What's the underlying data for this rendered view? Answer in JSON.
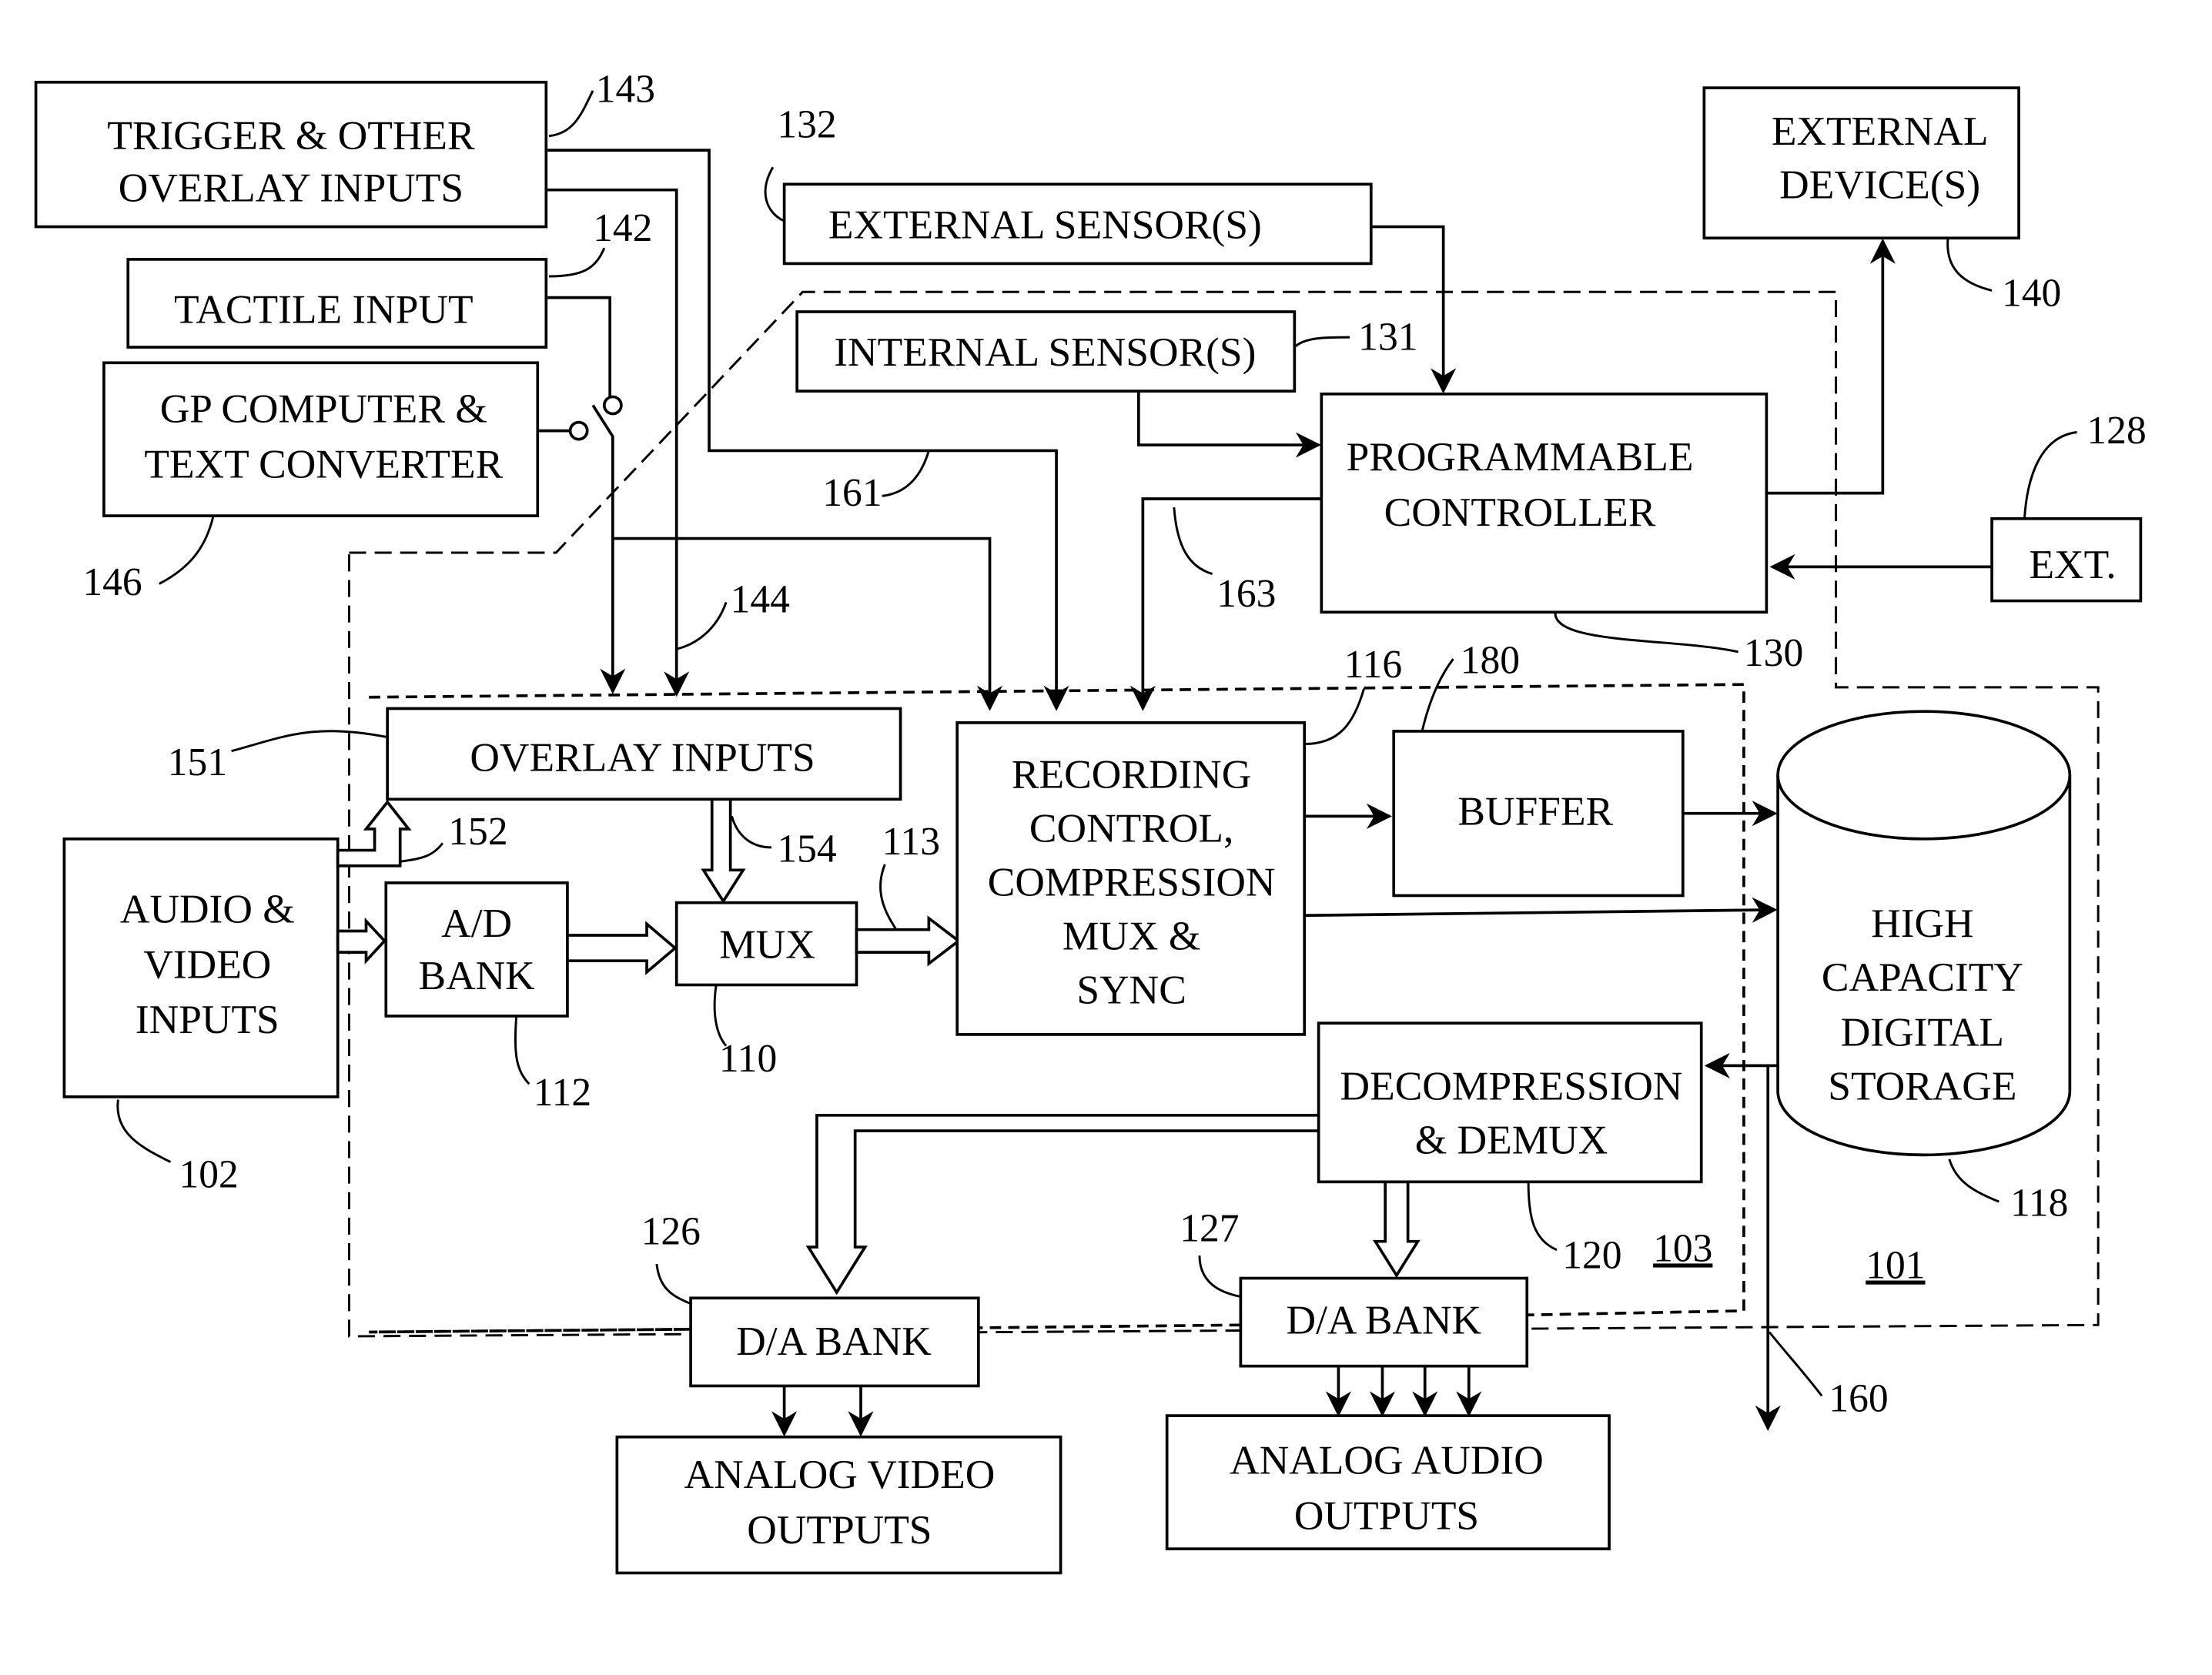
{
  "diagram": {
    "type": "block-diagram",
    "blocks": {
      "trigger": {
        "lines": [
          "TRIGGER & OTHER",
          "OVERLAY INPUTS"
        ],
        "ref": "143"
      },
      "tactile": {
        "lines": [
          "TACTILE INPUT"
        ],
        "ref": "142"
      },
      "gp_computer": {
        "lines": [
          "GP COMPUTER &",
          "TEXT CONVERTER"
        ],
        "ref": "146"
      },
      "external_sensors": {
        "lines": [
          "EXTERNAL SENSOR(S)"
        ],
        "ref": "132"
      },
      "internal_sensors": {
        "lines": [
          "INTERNAL SENSOR(S)"
        ],
        "ref": "131"
      },
      "external_devices": {
        "lines": [
          "EXTERNAL",
          "DEVICE(S)"
        ],
        "ref": "140"
      },
      "programmable_controller": {
        "lines": [
          "PROGRAMMABLE",
          "CONTROLLER"
        ],
        "ref": "130"
      },
      "ext": {
        "lines": [
          "EXT."
        ],
        "ref": "128"
      },
      "overlay_inputs": {
        "lines": [
          "OVERLAY INPUTS"
        ],
        "ref": "151"
      },
      "audio_video_inputs": {
        "lines": [
          "AUDIO &",
          "VIDEO",
          "INPUTS"
        ],
        "ref": "102"
      },
      "ad_bank": {
        "lines": [
          "A/D",
          "BANK"
        ],
        "ref": "112"
      },
      "mux": {
        "lines": [
          "MUX"
        ],
        "ref": "110"
      },
      "recording_control": {
        "lines": [
          "RECORDING",
          "CONTROL,",
          "COMPRESSION",
          "MUX &",
          "SYNC"
        ],
        "ref": "116"
      },
      "buffer": {
        "lines": [
          "BUFFER"
        ],
        "ref": "180"
      },
      "storage": {
        "lines": [
          "HIGH",
          "CAPACITY",
          "DIGITAL",
          "STORAGE"
        ],
        "ref": "118"
      },
      "decompression": {
        "lines": [
          "DECOMPRESSION",
          "& DEMUX"
        ],
        "ref": "120"
      },
      "da_bank_video": {
        "lines": [
          "D/A BANK"
        ],
        "ref": "126"
      },
      "da_bank_audio": {
        "lines": [
          "D/A BANK"
        ],
        "ref": "127"
      },
      "analog_video_outputs": {
        "lines": [
          "ANALOG VIDEO",
          "OUTPUTS"
        ]
      },
      "analog_audio_outputs": {
        "lines": [
          "ANALOG AUDIO",
          "OUTPUTS"
        ]
      }
    },
    "connection_refs": {
      "overlay_bus": "152",
      "overlay_to_mux": "154",
      "mux_to_recording": "113",
      "overlay_feed": "144",
      "trigger_to_recording": "161",
      "controller_to_recording": "163",
      "storage_output": "160"
    },
    "region_refs": {
      "inner_region": "103",
      "outer_region": "101"
    }
  }
}
